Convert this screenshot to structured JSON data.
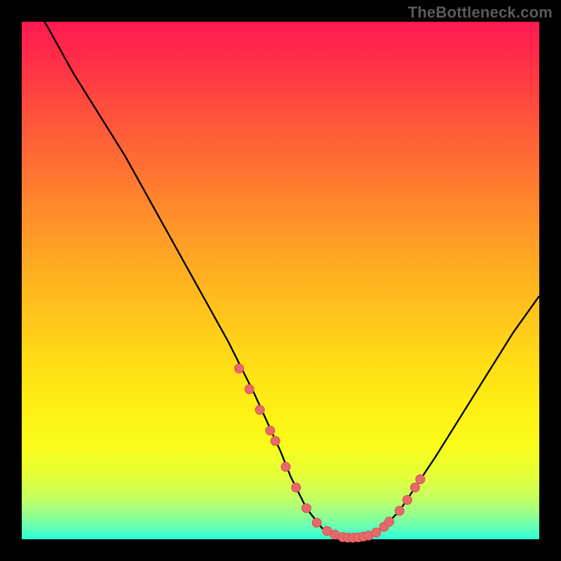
{
  "watermark": "TheBottleneck.com",
  "colors": {
    "frame": "#000000",
    "curve": "#000000",
    "marker_fill": "#e66a6a",
    "marker_stroke": "#d94f4f"
  },
  "chart_data": {
    "type": "line",
    "title": "",
    "xlabel": "",
    "ylabel": "",
    "xlim": [
      0,
      100
    ],
    "ylim": [
      0,
      100
    ],
    "grid": false,
    "legend": false,
    "series": [
      {
        "name": "bottleneck-curve",
        "x": [
          0,
          5,
          10,
          15,
          20,
          25,
          30,
          35,
          40,
          45,
          50,
          52,
          55,
          58,
          60,
          62,
          64,
          66,
          68,
          70,
          73,
          76,
          80,
          85,
          90,
          95,
          100
        ],
        "values": [
          107,
          99,
          90,
          82,
          74,
          65,
          56,
          47,
          38,
          28,
          17,
          12,
          6,
          2.2,
          0.9,
          0.4,
          0.3,
          0.5,
          1.0,
          2.4,
          5.5,
          10,
          16,
          24,
          32,
          40,
          47
        ]
      }
    ],
    "markers": {
      "name": "highlighted-points",
      "x": [
        42,
        44,
        46,
        48,
        49,
        51,
        53,
        55,
        57,
        59,
        60.5,
        62,
        63,
        64,
        65,
        66,
        67,
        68.5,
        70,
        71,
        73,
        74.5,
        76,
        77
      ],
      "values": [
        33,
        29,
        25,
        21,
        19,
        14,
        10,
        6,
        3.2,
        1.6,
        0.9,
        0.4,
        0.3,
        0.3,
        0.35,
        0.5,
        0.7,
        1.3,
        2.4,
        3.4,
        5.5,
        7.6,
        10,
        11.6
      ]
    }
  }
}
